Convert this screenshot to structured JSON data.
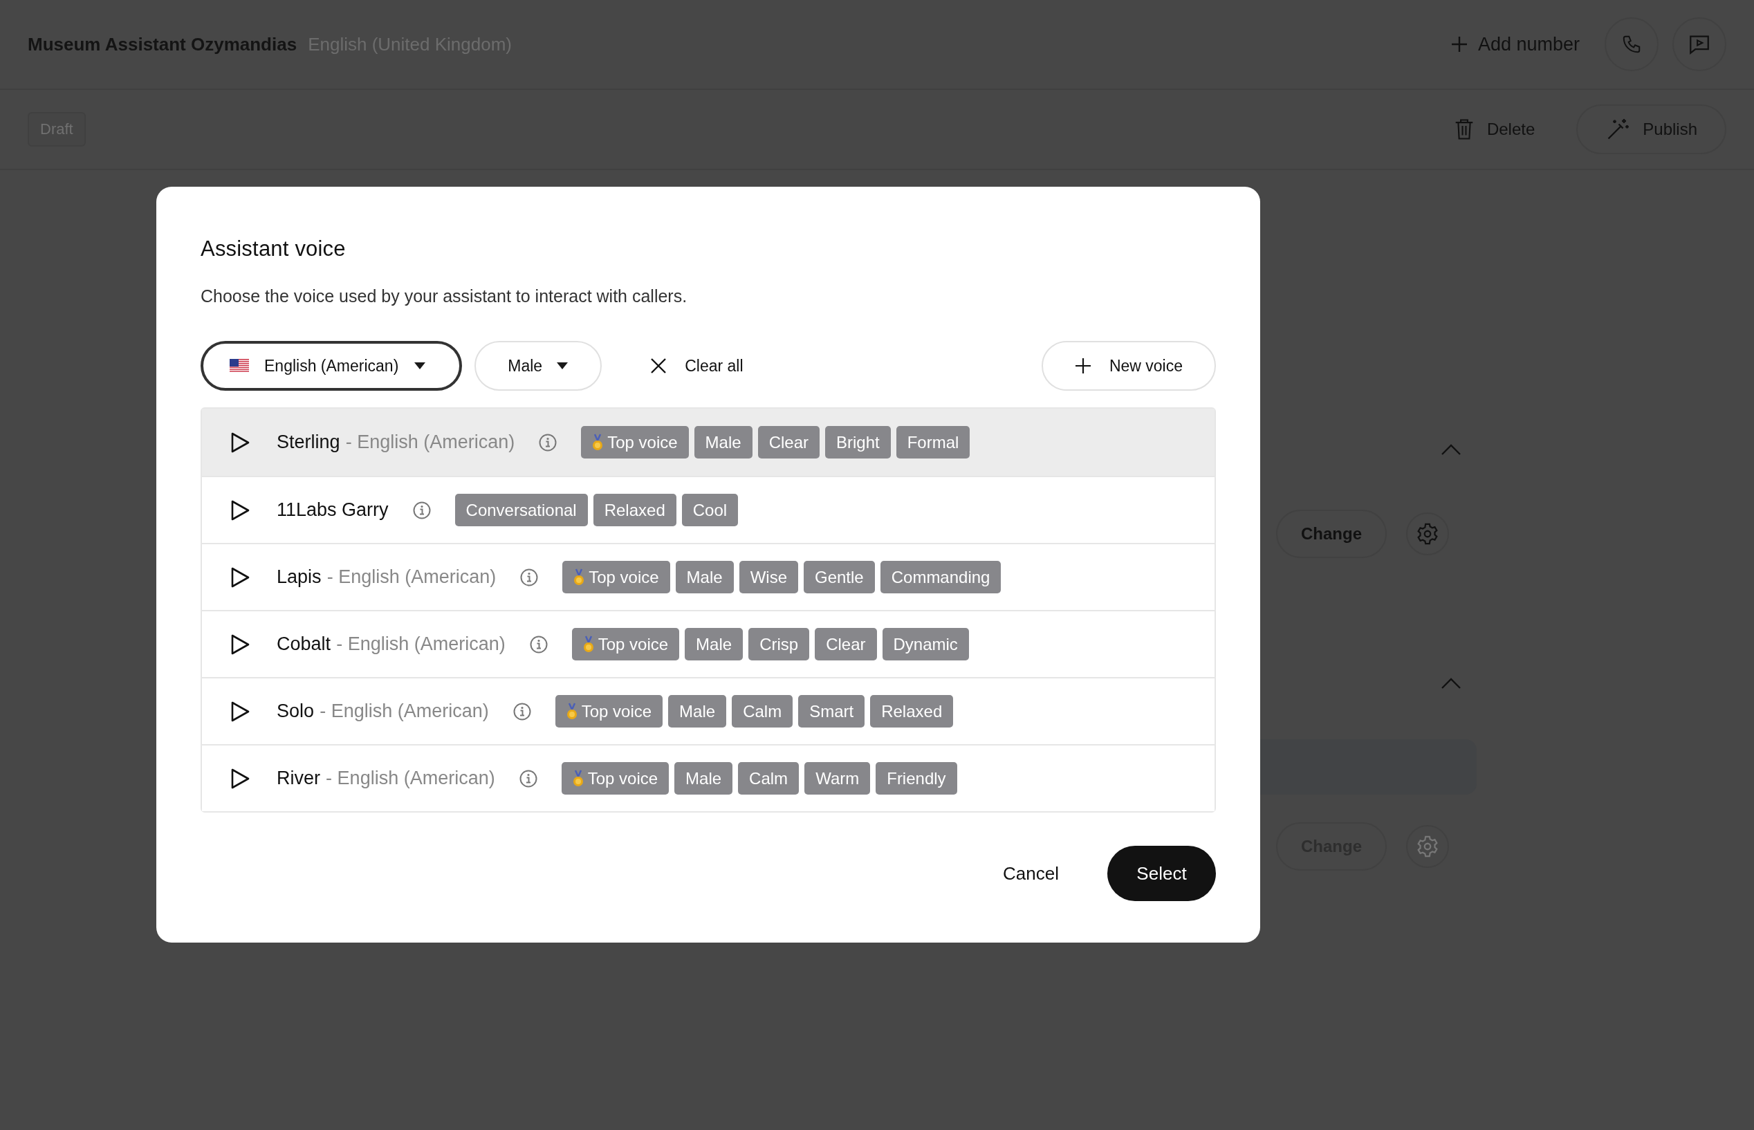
{
  "header": {
    "title": "Museum Assistant Ozymandias",
    "language": "English (United Kingdom)",
    "add_number": "Add number"
  },
  "toolbar": {
    "status": "Draft",
    "delete": "Delete",
    "publish": "Publish"
  },
  "sections": [
    {
      "expanded": true,
      "change": "Change",
      "disabled": false
    },
    {
      "expanded": true,
      "change": "Change",
      "disabled": true
    }
  ],
  "dialog": {
    "title": "Assistant voice",
    "description": "Choose the voice used by your assistant to interact with callers.",
    "filters": [
      {
        "label": "English (American)",
        "kind": "language",
        "focused": true
      },
      {
        "label": "Male",
        "kind": "plain",
        "focused": false
      }
    ],
    "clear_all": "Clear all",
    "new_voice": "New voice",
    "voices": [
      {
        "name": "Sterling",
        "detail": "- English (American)",
        "selected": true,
        "tags": [
          {
            "label": "Top voice",
            "kind": "top"
          },
          {
            "label": "Male",
            "kind": "plain"
          },
          {
            "label": "Clear",
            "kind": "plain"
          },
          {
            "label": "Bright",
            "kind": "plain"
          },
          {
            "label": "Formal",
            "kind": "plain"
          }
        ]
      },
      {
        "name": "11Labs Garry",
        "selected": false,
        "tags": [
          {
            "label": "Conversational",
            "kind": "plain"
          },
          {
            "label": "Relaxed",
            "kind": "plain"
          },
          {
            "label": "Cool",
            "kind": "plain"
          }
        ]
      },
      {
        "name": "Lapis",
        "detail": "- English (American)",
        "selected": false,
        "tags": [
          {
            "label": "Top voice",
            "kind": "top"
          },
          {
            "label": "Male",
            "kind": "plain"
          },
          {
            "label": "Wise",
            "kind": "plain"
          },
          {
            "label": "Gentle",
            "kind": "plain"
          },
          {
            "label": "Commanding",
            "kind": "plain"
          }
        ]
      },
      {
        "name": "Cobalt",
        "detail": "- English (American)",
        "selected": false,
        "tags": [
          {
            "label": "Top voice",
            "kind": "top"
          },
          {
            "label": "Male",
            "kind": "plain"
          },
          {
            "label": "Crisp",
            "kind": "plain"
          },
          {
            "label": "Clear",
            "kind": "plain"
          },
          {
            "label": "Dynamic",
            "kind": "plain"
          }
        ]
      },
      {
        "name": "Solo",
        "detail": "- English (American)",
        "selected": false,
        "tags": [
          {
            "label": "Top voice",
            "kind": "top"
          },
          {
            "label": "Male",
            "kind": "plain"
          },
          {
            "label": "Calm",
            "kind": "plain"
          },
          {
            "label": "Smart",
            "kind": "plain"
          },
          {
            "label": "Relaxed",
            "kind": "plain"
          }
        ]
      },
      {
        "name": "River",
        "detail": "- English (American)",
        "selected": false,
        "tags": [
          {
            "label": "Top voice",
            "kind": "top"
          },
          {
            "label": "Male",
            "kind": "plain"
          },
          {
            "label": "Calm",
            "kind": "plain"
          },
          {
            "label": "Warm",
            "kind": "plain"
          },
          {
            "label": "Friendly",
            "kind": "plain"
          }
        ]
      }
    ],
    "cancel": "Cancel",
    "select": "Select"
  }
}
